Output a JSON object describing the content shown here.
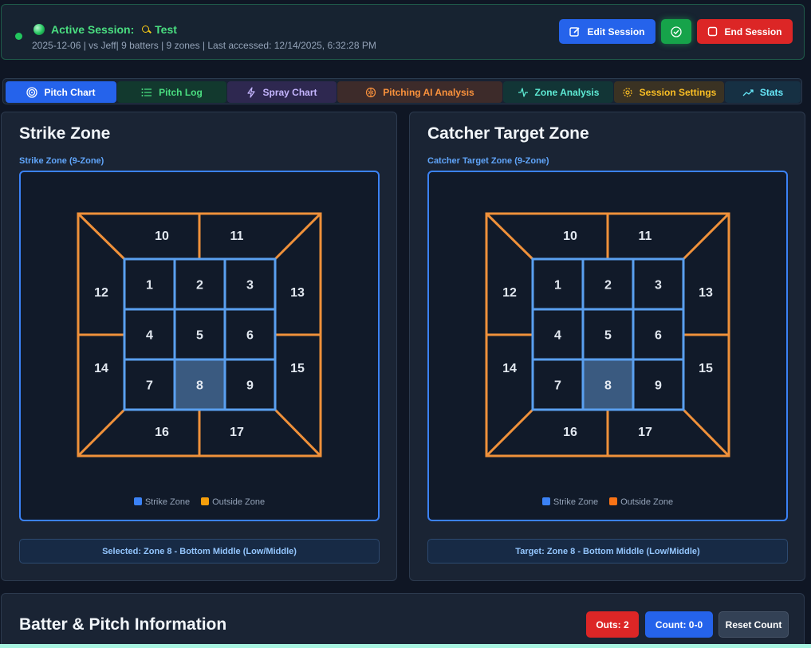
{
  "session": {
    "label": "Active Session:",
    "name": "Test",
    "meta": "2025-12-06 | vs Jeff| 9 batters | 9 zones | Last accessed: 12/14/2025, 6:32:28 PM",
    "edit_label": "Edit Session",
    "end_label": "End Session"
  },
  "tabs": [
    {
      "label": "Pitch Chart",
      "icon": "target-icon",
      "active": true
    },
    {
      "label": "Pitch Log",
      "icon": "list-icon"
    },
    {
      "label": "Spray Chart",
      "icon": "lightning-icon"
    },
    {
      "label": "Pitching AI Analysis",
      "icon": "brain-icon"
    },
    {
      "label": "Zone Analysis",
      "icon": "activity-icon"
    },
    {
      "label": "Session Settings",
      "icon": "gear-icon"
    },
    {
      "label": "Stats",
      "icon": "trending-icon"
    }
  ],
  "strike_panel": {
    "title": "Strike Zone",
    "subtitle": "Strike Zone (9-Zone)",
    "selected_zone": 8,
    "legend_in": "Strike Zone",
    "legend_out": "Outside Zone",
    "status": "Selected: Zone 8 - Bottom Middle (Low/Middle)"
  },
  "target_panel": {
    "title": "Catcher Target Zone",
    "subtitle": "Catcher Target Zone (9-Zone)",
    "selected_zone": 8,
    "legend_in": "Strike Zone",
    "legend_out": "Outside Zone",
    "status": "Target: Zone 8 - Bottom Middle (Low/Middle)"
  },
  "zones": {
    "inner": [
      "1",
      "2",
      "3",
      "4",
      "5",
      "6",
      "7",
      "8",
      "9"
    ],
    "outer": [
      "10",
      "11",
      "12",
      "13",
      "14",
      "15",
      "16",
      "17"
    ]
  },
  "batter": {
    "title": "Batter & Pitch Information",
    "outs_label": "Outs: 2",
    "count_label": "Count: 0-0",
    "reset_label": "Reset Count"
  },
  "colors": {
    "inner_stroke": "#5aa0f0",
    "outer_stroke": "#f0913a",
    "selected_fill": "#3a5a80",
    "legend_in": "#3b82f6",
    "legend_out_left": "#f59e0b",
    "legend_out_right": "#f97316"
  }
}
